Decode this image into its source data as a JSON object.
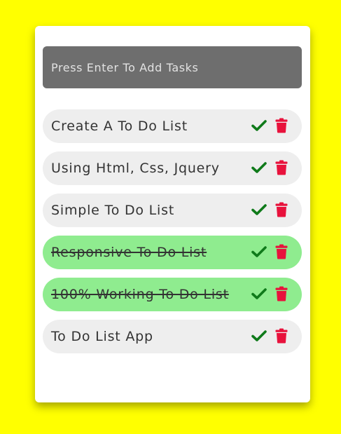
{
  "input": {
    "placeholder": "Press Enter To Add Tasks",
    "value": ""
  },
  "tasks": [
    {
      "text": "Create A To Do List",
      "completed": false
    },
    {
      "text": "Using Html, Css, Jquery",
      "completed": false
    },
    {
      "text": "Simple To Do List",
      "completed": false
    },
    {
      "text": "Responsive To Do List",
      "completed": true
    },
    {
      "text": "100% Working To Do List",
      "completed": true
    },
    {
      "text": "To Do List App",
      "completed": false
    }
  ],
  "icons": {
    "complete": "check-icon",
    "delete": "trash-icon"
  },
  "colors": {
    "background": "#ffff00",
    "input_bg": "#6e6e6e",
    "task_bg": "#eeeeee",
    "task_done_bg": "#8fec8f",
    "check": "#0f7a1a",
    "trash": "#e8123c"
  }
}
